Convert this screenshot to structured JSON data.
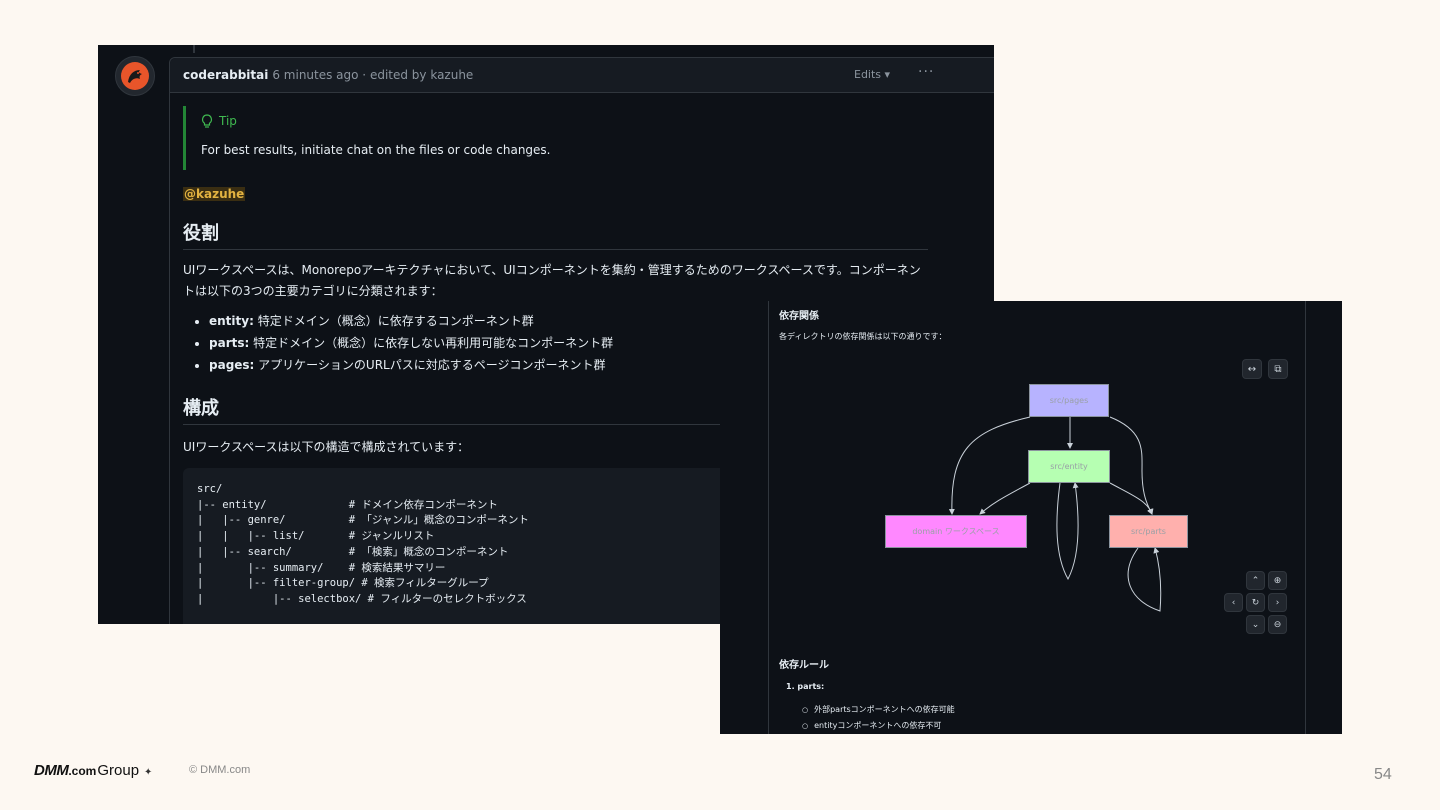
{
  "shot1": {
    "author": "coderabbitai",
    "meta": "6 minutes ago · edited by kazuhe",
    "edits_label": "Edits",
    "tip_title": "Tip",
    "tip_text": "For best results, initiate chat on the files or code changes.",
    "mention": "@kazuhe",
    "role_heading": "役割",
    "role_text": "UIワークスペースは、Monorepoアーキテクチャにおいて、UIコンポーネントを集約・管理するためのワークスペースです。コンポーネントは以下の3つの主要カテゴリに分類されます：",
    "categories": [
      {
        "key": "entity:",
        "desc": " 特定ドメイン（概念）に依存するコンポーネント群"
      },
      {
        "key": "parts:",
        "desc": " 特定ドメイン（概念）に依存しない再利用可能なコンポーネント群"
      },
      {
        "key": "pages:",
        "desc": " アプリケーションのURLパスに対応するページコンポーネント群"
      }
    ],
    "structure_heading": "構成",
    "structure_text": "UIワークスペースは以下の構造で構成されています：",
    "code": "src/\n|-- entity/             # ドメイン依存コンポーネント\n|   |-- genre/          # 「ジャンル」概念のコンポーネント\n|   |   |-- list/       # ジャンルリスト\n|   |-- search/         # 「検索」概念のコンポーネント\n|       |-- summary/    # 検索結果サマリー\n|       |-- filter-group/ # 検索フィルターグループ\n|           |-- selectbox/ # フィルターのセレクトボックス"
  },
  "shot2": {
    "dep_title": "依存関係",
    "dep_desc": "各ディレクトリの依存関係は以下の通りです：",
    "nodes": {
      "pages": "src/pages",
      "entity": "src/entity",
      "domain": "domain ワークスペース",
      "parts": "src/parts"
    },
    "node_colors": {
      "pages": "#b7b3ff",
      "entity": "#b6ffb2",
      "domain": "#ff88ff",
      "parts": "#ffb0ad"
    },
    "rules_title": "依存ルール",
    "rule_1": "1. parts:",
    "rule_items": [
      "外部partsコンポーネントへの依存可能",
      "entityコンポーネントへの依存不可"
    ]
  },
  "footer": {
    "brand_dmm": "DMM",
    "brand_com": ".com",
    "brand_group": "Group",
    "copyright": "© DMM.com",
    "page_number": "54"
  }
}
